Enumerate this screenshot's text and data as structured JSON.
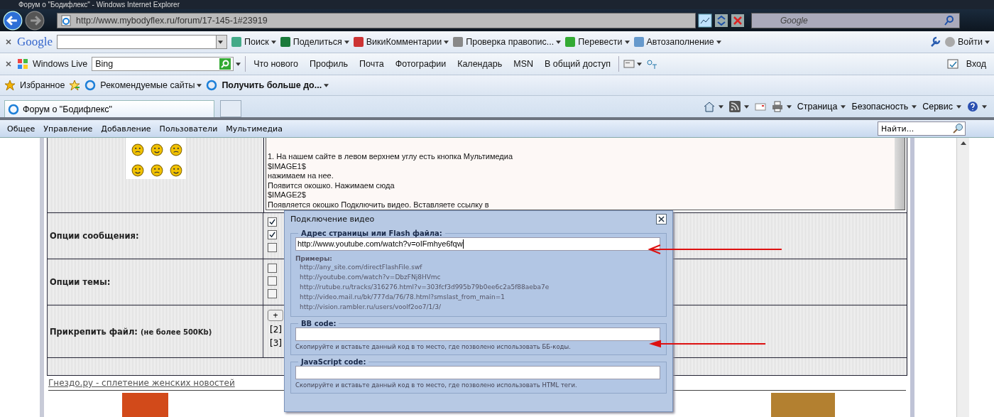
{
  "window": {
    "title": "Форум о \"Бодифлекс\" - Windows Internet Explorer"
  },
  "address_bar": {
    "url": "http://www.mybodyflex.ru/forum/17-145-1#23919",
    "search_placeholder": "Google"
  },
  "google_toolbar": {
    "logo": "Google",
    "items": [
      {
        "label": "Поиск",
        "dropdown": true
      },
      {
        "label": "Поделиться",
        "dropdown": true
      },
      {
        "label": "ВикиКомментарии",
        "dropdown": true
      },
      {
        "label": "Проверка правопис...",
        "dropdown": true
      },
      {
        "label": "Перевести",
        "dropdown": true
      },
      {
        "label": "Автозаполнение",
        "dropdown": true
      }
    ],
    "signin": "Войти"
  },
  "windows_live_toolbar": {
    "brand": "Windows Live",
    "search_value": "Bing",
    "links": [
      "Что нового",
      "Профиль",
      "Почта",
      "Фотографии",
      "Календарь",
      "MSN",
      "В общий доступ"
    ],
    "signin": "Вход"
  },
  "favorites_bar": {
    "favorites": "Избранное",
    "items": [
      {
        "label": "Рекомендуемые сайты",
        "bold": false
      },
      {
        "label": "Получить больше до...",
        "bold": true
      }
    ]
  },
  "tabs": [
    {
      "label": "Форум о \"Бодифлекс\"",
      "selected": true
    }
  ],
  "command_bar": {
    "items": [
      "Страница",
      "Безопасность",
      "Сервис"
    ]
  },
  "forum_menu": {
    "items": [
      "Общее",
      "Управление",
      "Добавление",
      "Пользователи",
      "Мультимедиа"
    ],
    "search_placeholder": "Найти..."
  },
  "form": {
    "message_lines": [
      "1. На нашем сайте в левом верхнем углу есть кнопка Мультимедиа",
      "$IMAGE1$",
      "нажимаем на нее.",
      "Появится окошко. Нажимаем сюда",
      "$IMAGE2$",
      "Появляется окошко Подключить видео. Вставляете ссылку в"
    ],
    "rows": [
      {
        "kind": "checkboxes",
        "label": "Опции сообщения:",
        "checkboxes": [
          {
            "checked": true
          },
          {
            "checked": true
          },
          {
            "checked": false
          }
        ]
      },
      {
        "kind": "checkboxes",
        "label": "Опции темы:",
        "checkboxes": [
          {
            "checked": false
          },
          {
            "checked": false
          },
          {
            "checked": false
          }
        ]
      },
      {
        "kind": "attach",
        "label": "Прикрепить файл:",
        "note": "(не более 500Kb)",
        "add": "+",
        "slots": [
          "[2]",
          "[3]"
        ]
      }
    ]
  },
  "footer_link": "Гнездо.ру - сплетение женских новостей",
  "dialog": {
    "title": "Подключение видео",
    "url_group": {
      "legend": "Адрес страницы или Flash файла:",
      "value": "http://www.youtube.com/watch?v=oIFmhye6fqw",
      "examples_label": "Примеры:",
      "examples": [
        "http://any_site.com/directFlashFile.swf",
        "http://youtube.com/watch?v=DbzFNj8HVmc",
        "http://rutube.ru/tracks/316276.html?v=303fcf3d995b79b0ee6c2a5f88aeba7e",
        "http://video.mail.ru/bk/777da/76/78.html?smslast_from_main=1",
        "http://vision.rambler.ru/users/voolf2oo7/1/3/"
      ]
    },
    "bb_group": {
      "legend": "BB code:",
      "hint": "Скопируйте и вставьте данный код в то место, где позволено использовать ББ-коды."
    },
    "js_group": {
      "legend": "JavaScript code:",
      "hint": "Скопируйте и вставьте данный код в то место, где позволено использовать HTML теги."
    }
  }
}
